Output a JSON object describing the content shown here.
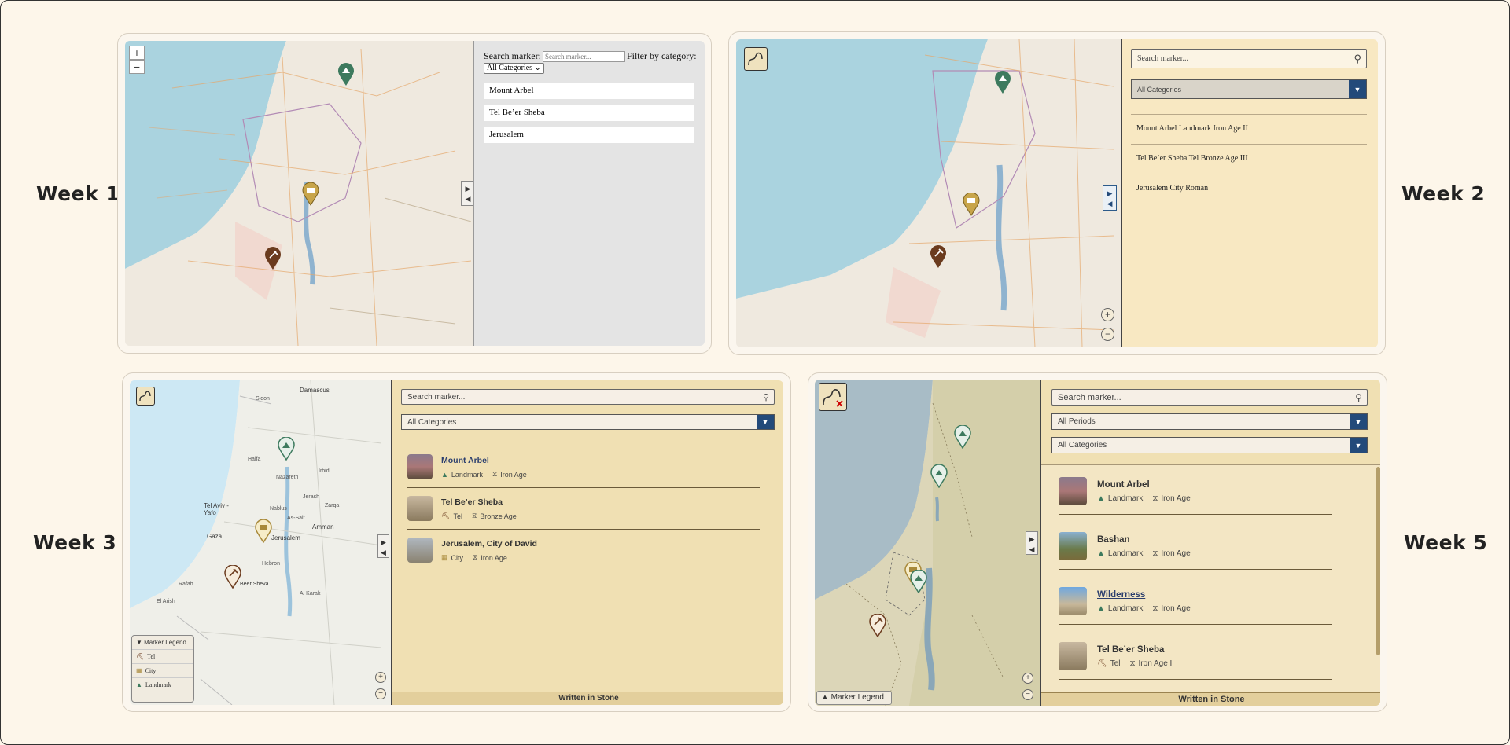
{
  "weeks": {
    "w1": "Week 1",
    "w2": "Week  2",
    "w3": "Week  3",
    "w5": "Week  5"
  },
  "week1": {
    "search_label": "Search marker:",
    "search_placeholder": "Search marker...",
    "filter_label": "Filter by category:",
    "category_value": "All Categories",
    "zoom_in": "+",
    "zoom_out": "−",
    "toggle": "▶\n◀",
    "items": [
      "Mount Arbel",
      "Tel Be’er Sheba",
      "Jerusalem"
    ]
  },
  "week2": {
    "search_placeholder": "Search marker...",
    "category_value": "All Categories",
    "items": [
      "Mount Arbel Landmark Iron Age II",
      "Tel Be’er Sheba Tel Bronze Age III",
      "Jerusalem City Roman"
    ],
    "zoom_in": "+",
    "zoom_out": "−"
  },
  "week3": {
    "search_placeholder": "Search marker...",
    "category_value": "All Categories",
    "items": [
      {
        "title": "Mount Arbel",
        "category": "Landmark",
        "period": "Iron Age"
      },
      {
        "title": "Tel Be’er Sheba",
        "category": "Tel",
        "period": "Bronze Age"
      },
      {
        "title": "Jerusalem, City of David",
        "category": "City",
        "period": "Iron Age"
      }
    ],
    "legend": {
      "title": "▼ Marker Legend",
      "entries": [
        "Tel",
        "City",
        "Landmark"
      ]
    },
    "map_labels": [
      "Damascus",
      "Tel Aviv -\nYafo",
      "Amman",
      "Jerusalem",
      "Gaza",
      "Beer Sheva",
      "Nazareth",
      "Haifa",
      "Irbid",
      "Nablus",
      "As-Salt",
      "Al Karak",
      "Jerash",
      "Zarqa",
      "Rafah",
      "El Arish",
      "Hebron",
      "Sidon"
    ],
    "footer": "Written in Stone",
    "zoom_in": "+",
    "zoom_out": "−"
  },
  "week5": {
    "search_placeholder": "Search marker...",
    "period_value": "All Periods",
    "category_value": "All Categories",
    "items": [
      {
        "title": "Mount Arbel",
        "category": "Landmark",
        "period": "Iron Age"
      },
      {
        "title": "Bashan",
        "category": "Landmark",
        "period": "Iron Age"
      },
      {
        "title": "Wilderness",
        "category": "Landmark",
        "period": "Iron Age"
      },
      {
        "title": "Tel Be’er Sheba",
        "category": "Tel",
        "period": "Iron Age I"
      }
    ],
    "legend_button": "▲ Marker Legend",
    "footer": "Written in Stone",
    "zoom_in": "+",
    "zoom_out": "−"
  },
  "colors": {
    "sea": "#aad3df",
    "land": "#f2efe9",
    "panel_tan": "#f8e8c2",
    "panel_tan2": "#f0e0b3",
    "accent_blue": "#234a7a",
    "landmark_green": "#3d7a5e",
    "tel_brown": "#6b3b1e",
    "city_gold": "#c8a54a"
  }
}
